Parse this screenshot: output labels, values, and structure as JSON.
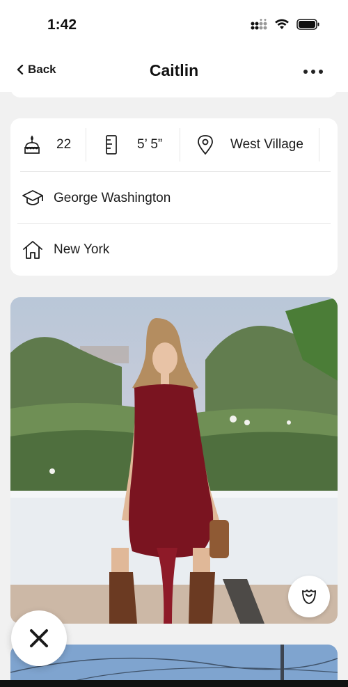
{
  "status_bar": {
    "time": "1:42"
  },
  "nav": {
    "back_label": "Back",
    "title": "Caitlin"
  },
  "profile": {
    "age": "22",
    "height": "5’ 5”",
    "location": "West Village",
    "school": "George Washington",
    "hometown": "New York"
  },
  "icons": {
    "age": "cake-icon",
    "height": "ruler-icon",
    "location": "location-pin-icon",
    "school": "graduation-cap-icon",
    "hometown": "home-icon",
    "like": "rose-icon",
    "skip": "x-icon",
    "more": "more-dots-icon",
    "back": "chevron-left-icon"
  },
  "colors": {
    "background": "#f1f1f1",
    "card": "#ffffff",
    "text": "#1a1a1a",
    "dress": "#7a1420"
  }
}
